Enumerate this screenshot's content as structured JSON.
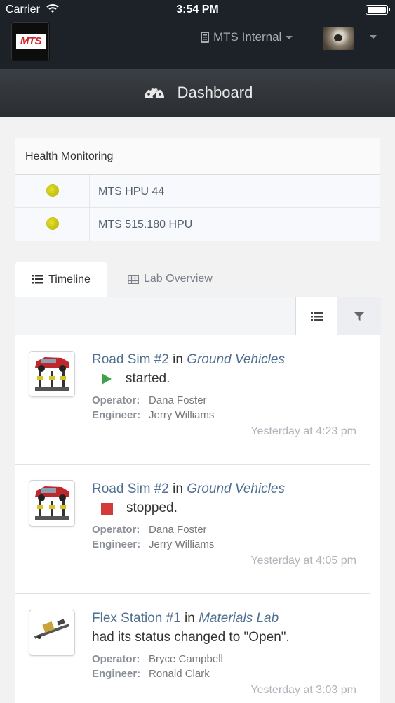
{
  "status_bar": {
    "carrier": "Carrier",
    "time": "3:54 PM"
  },
  "header": {
    "logo_text": "MTS",
    "org_name": "MTS Internal"
  },
  "subheader": {
    "title": "Dashboard"
  },
  "health": {
    "title": "Health Monitoring",
    "items": [
      {
        "label": "MTS HPU 44",
        "status_color": "#c7c410"
      },
      {
        "label": "MTS 515.180 HPU",
        "status_color": "#c7c410"
      }
    ]
  },
  "tabs": {
    "timeline": "Timeline",
    "lab_overview": "Lab Overview"
  },
  "timeline": [
    {
      "device": "Road Sim #2",
      "in_word": "in",
      "lab": "Ground Vehicles",
      "state": "started.",
      "state_icon": "play-icon",
      "operator_label": "Operator:",
      "operator": "Dana Foster",
      "engineer_label": "Engineer:",
      "engineer": "Jerry Williams",
      "time": "Yesterday at 4:23 pm"
    },
    {
      "device": "Road Sim #2",
      "in_word": "in",
      "lab": "Ground Vehicles",
      "state": "stopped.",
      "state_icon": "stop-icon",
      "operator_label": "Operator:",
      "operator": "Dana Foster",
      "engineer_label": "Engineer:",
      "engineer": "Jerry Williams",
      "time": "Yesterday at 4:05 pm"
    },
    {
      "device": "Flex Station #1",
      "in_word": "in",
      "lab": "Materials Lab",
      "state": "had its status changed to \"Open\".",
      "operator_label": "Operator:",
      "operator": "Bryce Campbell",
      "engineer_label": "Engineer:",
      "engineer": "Ronald Clark",
      "time": "Yesterday at 3:03 pm"
    }
  ],
  "colors": {
    "accent": "#4f6f91",
    "started": "#3fa14a",
    "stopped": "#d33b3b",
    "nav_bg": "#1d2128"
  }
}
